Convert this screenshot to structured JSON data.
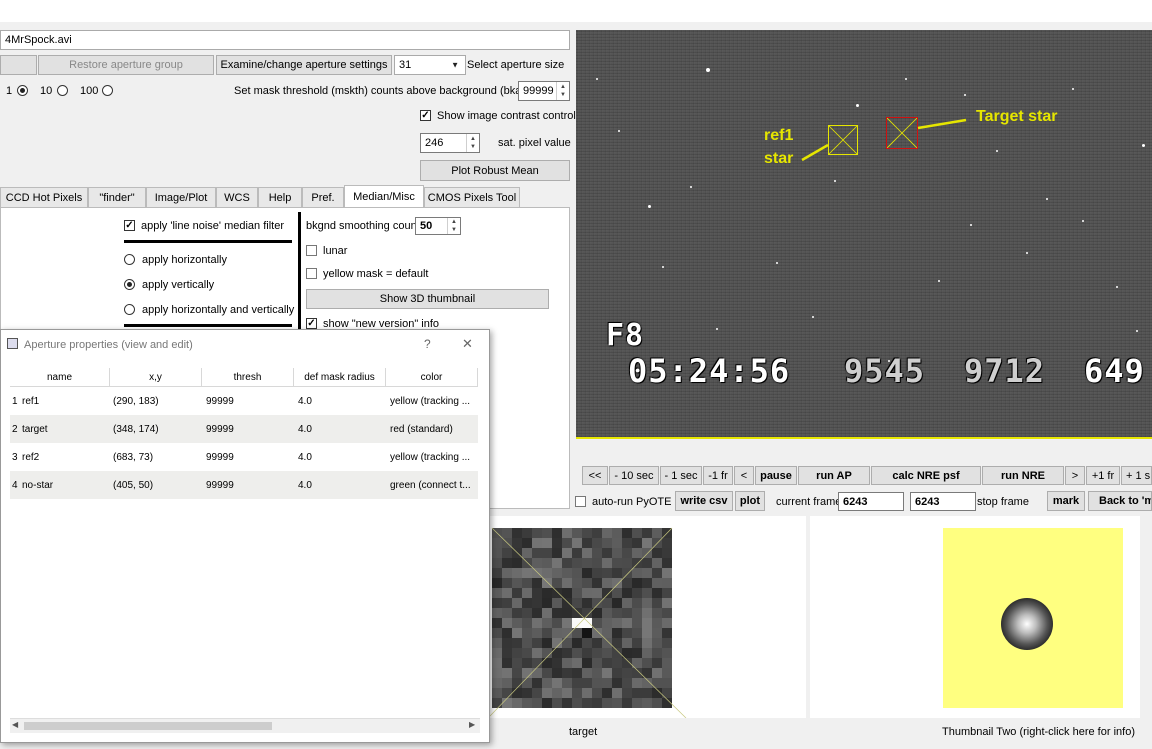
{
  "file": {
    "name": "4MrSpock.avi"
  },
  "controls": {
    "restore_label": "Restore aperture group",
    "examine_label": "Examine/change aperture settings",
    "aperture_size_value": "31",
    "aperture_size_label": "Select aperture size",
    "radio_1": "1",
    "radio_10": "10",
    "radio_100": "100",
    "mask_threshold_label": "Set mask threshold (mskth) counts above background (bkavg)",
    "mask_threshold_value": "99999",
    "show_contrast_label": "Show image contrast control",
    "sat_value": "246",
    "sat_label": "sat. pixel value",
    "plot_robust_label": "Plot Robust Mean"
  },
  "tabs": [
    "CCD Hot Pixels",
    "\"finder\"",
    "Image/Plot",
    "WCS",
    "Help",
    "Pref.",
    "Median/Misc",
    "CMOS Pixels Tool"
  ],
  "median": {
    "line_noise_label": "apply 'line noise' median filter",
    "horiz_label": "apply horizontally",
    "vert_label": "apply vertically",
    "both_label": "apply horizontally and vertically",
    "bkgnd_label": "bkgnd smoothing count",
    "bkgnd_value": "50",
    "lunar_label": "lunar",
    "yellow_mask_label": "yellow mask = default",
    "show3d_label": "Show 3D thumbnail",
    "new_version_label": "show \"new version\" info"
  },
  "dialog": {
    "title": "Aperture properties (view and edit)",
    "help": "?",
    "close": "✕",
    "columns": [
      "name",
      "x,y",
      "thresh",
      "def mask radius",
      "color"
    ],
    "rows": [
      {
        "num": "1",
        "name": "ref1",
        "xy": "(290, 183)",
        "thresh": "99999",
        "radius": "4.0",
        "color": "yellow (tracking ..."
      },
      {
        "num": "2",
        "name": "target",
        "xy": "(348, 174)",
        "thresh": "99999",
        "radius": "4.0",
        "color": "red (standard)"
      },
      {
        "num": "3",
        "name": "ref2",
        "xy": "(683, 73)",
        "thresh": "99999",
        "radius": "4.0",
        "color": "yellow (tracking ..."
      },
      {
        "num": "4",
        "name": "no-star",
        "xy": "(405, 50)",
        "thresh": "99999",
        "radius": "4.0",
        "color": "green (connect t..."
      }
    ]
  },
  "image": {
    "overlay_field": "F8",
    "overlay_time": "05:24:56",
    "overlay_n1": "9545",
    "overlay_n2": "9712",
    "overlay_n3": "649",
    "annot_ref1_line1": "ref1",
    "annot_ref1_line2": "star",
    "annot_target": "Target star",
    "colors": {
      "yellow": "#e6e600",
      "red": "#d01010"
    }
  },
  "playback": {
    "buttons": [
      "<<",
      "- 10 sec",
      "- 1 sec",
      "-1 fr",
      "<",
      "pause",
      "run AP",
      "calc NRE psf",
      "run NRE",
      ">",
      "+1 fr",
      "+ 1 s"
    ],
    "auto_run_label": "auto-run PyOTE",
    "write_csv_label": "write csv",
    "plot_label": "plot",
    "current_frame_label": "current frame",
    "current_frame_value": "6243",
    "stop_frame_value": "6243",
    "stop_frame_label": "stop frame",
    "mark_label": "mark",
    "back_label": "Back to 'm"
  },
  "thumbnails": {
    "one_label": "target",
    "two_label": "Thumbnail Two (right-click here for info)"
  }
}
